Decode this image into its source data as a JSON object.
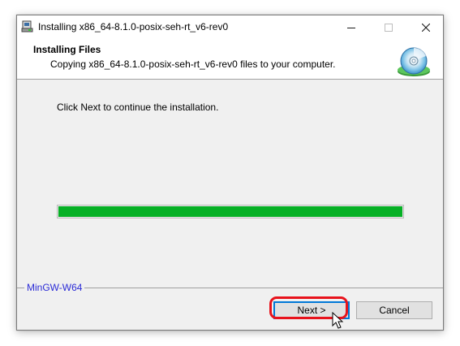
{
  "window": {
    "title": "Installing x86_64-8.1.0-posix-seh-rt_v6-rev0",
    "controls": {
      "minimize_icon": "minimize-icon",
      "maximize_icon": "maximize-icon",
      "close_icon": "close-icon"
    }
  },
  "header": {
    "title": "Installing Files",
    "subtitle": "Copying x86_64-8.1.0-posix-seh-rt_v6-rev0 files to your computer.",
    "icon": "installer-disc-icon"
  },
  "content": {
    "message": "Click Next to continue the installation.",
    "progress": {
      "percent": 100,
      "color": "#06b025"
    }
  },
  "footer": {
    "brand": "MinGW-W64",
    "buttons": {
      "next": "Next >",
      "cancel": "Cancel"
    }
  },
  "colors": {
    "accent": "#0078d7",
    "brand_text": "#2b2bd6",
    "highlight": "#e8131c"
  }
}
